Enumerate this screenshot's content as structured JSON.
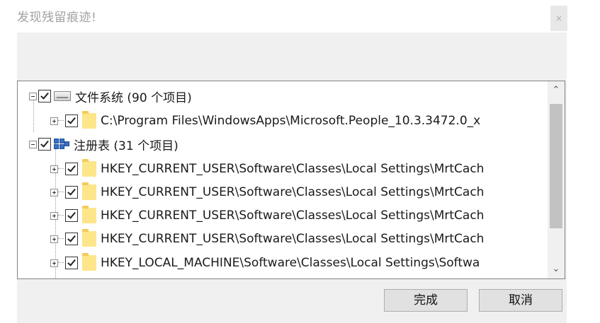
{
  "window": {
    "title": "发现残留痕迹!",
    "close_label": "×"
  },
  "tree": {
    "groups": [
      {
        "label": "文件系统 (90 个项目)",
        "children": [
          {
            "label": "C:\\Program Files\\WindowsApps\\Microsoft.People_10.3.3472.0_x"
          }
        ]
      },
      {
        "label": "注册表 (31 个项目)",
        "children": [
          {
            "label": "HKEY_CURRENT_USER\\Software\\Classes\\Local Settings\\MrtCach"
          },
          {
            "label": "HKEY_CURRENT_USER\\Software\\Classes\\Local Settings\\MrtCach"
          },
          {
            "label": "HKEY_CURRENT_USER\\Software\\Classes\\Local Settings\\MrtCach"
          },
          {
            "label": "HKEY_CURRENT_USER\\Software\\Classes\\Local Settings\\MrtCach"
          },
          {
            "label": "HKEY_LOCAL_MACHINE\\Software\\Classes\\Local Settings\\Softwa"
          }
        ]
      }
    ]
  },
  "buttons": {
    "finish_label": "完成",
    "cancel_label": "取消"
  },
  "icons": {
    "expand": "expand-icon",
    "collapse": "collapse-icon",
    "checkbox": "checkbox-checked",
    "drive": "drive-icon",
    "registry": "registry-icon",
    "folder": "folder-icon"
  },
  "colors": {
    "panel_bg": "#f0f0f0",
    "folder": "#fde58a",
    "registry_blue": "#3a6fc4",
    "scroll_thumb": "#c2c2c2"
  }
}
